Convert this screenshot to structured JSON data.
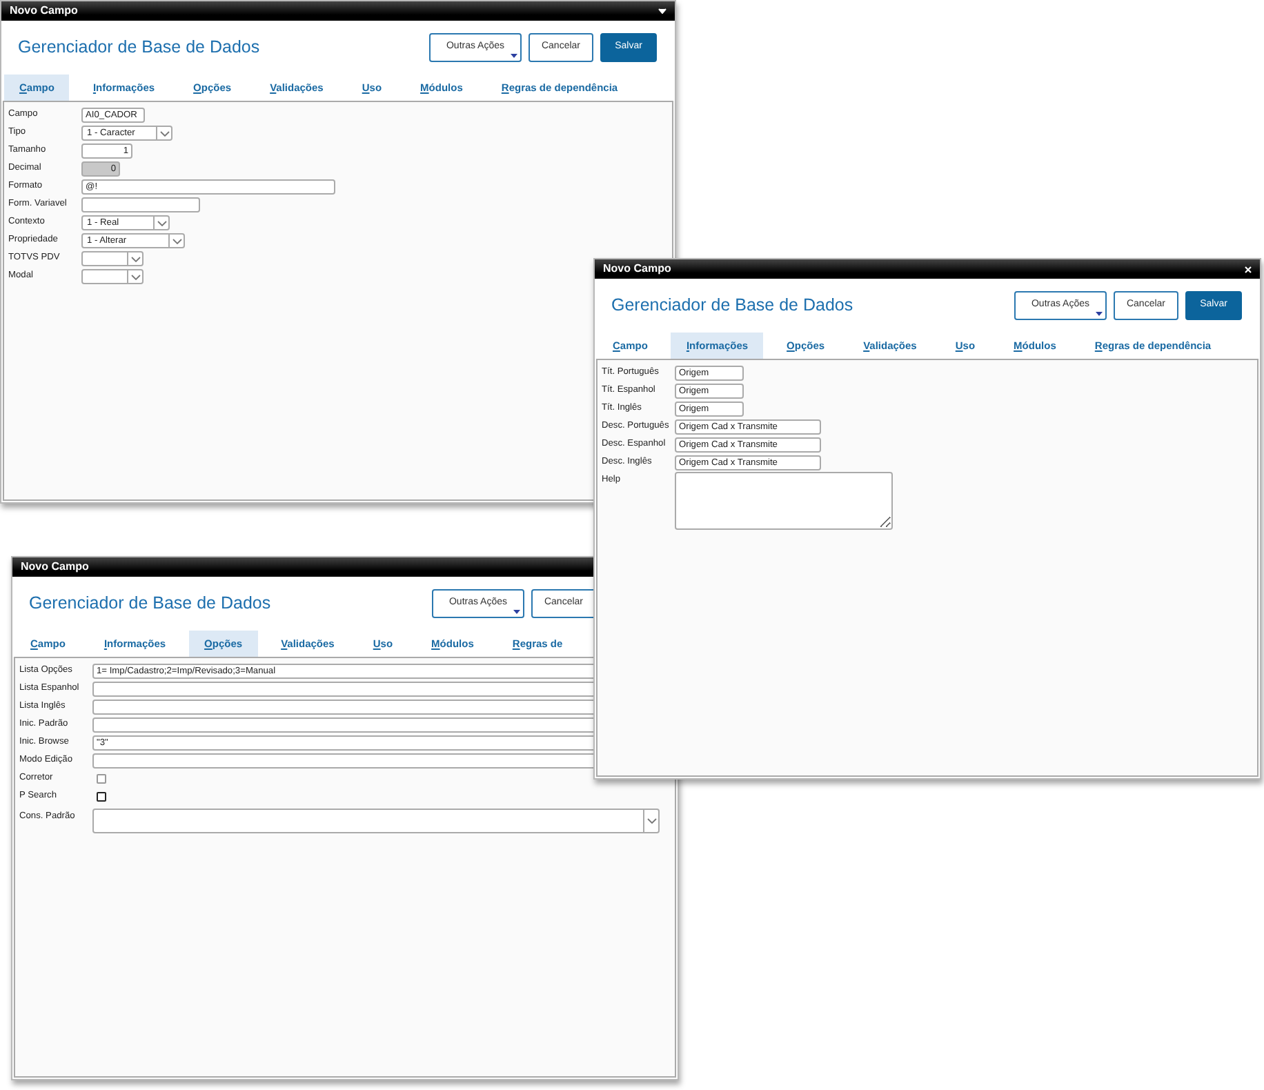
{
  "windows": [
    {
      "title": "Novo Campo",
      "collapse_button": true,
      "heading": "Gerenciador de Base de Dados",
      "buttons": [
        {
          "label": "Outras Ações",
          "kind": "menu"
        },
        {
          "label": "Cancelar",
          "kind": "default"
        },
        {
          "label": "Salvar",
          "kind": "primary"
        }
      ],
      "tabs": [
        {
          "label": "Campo",
          "selected": true
        },
        {
          "label": "Informações",
          "selected": false
        },
        {
          "label": "Opções",
          "selected": false
        },
        {
          "label": "Validações",
          "selected": false
        },
        {
          "label": "Uso",
          "selected": false
        },
        {
          "label": "Módulos",
          "selected": false
        },
        {
          "label": "Regras de dependência",
          "selected": false
        }
      ],
      "fields": [
        {
          "label": "Campo",
          "kind": "text",
          "value": "AI0_CADOR",
          "disabled": false
        },
        {
          "label": "Tipo",
          "kind": "select",
          "value": "1 - Caracter",
          "disabled": false
        },
        {
          "label": "Tamanho",
          "kind": "number",
          "value": "1",
          "disabled": false
        },
        {
          "label": "Decimal",
          "kind": "number",
          "value": "0",
          "disabled": true
        },
        {
          "label": "Formato",
          "kind": "text",
          "value": "@!",
          "disabled": false
        },
        {
          "label": "Form. Variavel",
          "kind": "text",
          "disabled": false
        },
        {
          "label": "Contexto",
          "kind": "select",
          "value": "1 - Real",
          "disabled": false
        },
        {
          "label": "Propriedade",
          "kind": "select",
          "value": "1 - Alterar",
          "disabled": false
        },
        {
          "label": "TOTVS PDV",
          "kind": "select",
          "disabled": false
        },
        {
          "label": "Modal",
          "kind": "select",
          "disabled": false
        }
      ]
    },
    {
      "title": "Novo Campo",
      "close_button": true,
      "heading": "Gerenciador de Base de Dados",
      "buttons": [
        {
          "label": "Outras Ações",
          "kind": "menu"
        },
        {
          "label": "Cancelar",
          "kind": "default"
        },
        {
          "label": "Salvar",
          "kind": "primary"
        }
      ],
      "tabs": [
        {
          "label": "Campo",
          "selected": false
        },
        {
          "label": "Informações",
          "selected": true
        },
        {
          "label": "Opções",
          "selected": false
        },
        {
          "label": "Validações",
          "selected": false
        },
        {
          "label": "Uso",
          "selected": false
        },
        {
          "label": "Módulos",
          "selected": false
        },
        {
          "label": "Regras de dependência",
          "selected": false
        }
      ],
      "fields": [
        {
          "label": "Tít. Português",
          "kind": "text",
          "value": "Origem",
          "disabled": false
        },
        {
          "label": "Tít. Espanhol",
          "kind": "text",
          "value": "Origem",
          "disabled": false
        },
        {
          "label": "Tít. Inglês",
          "kind": "text",
          "value": "Origem",
          "disabled": false
        },
        {
          "label": "Desc. Português",
          "kind": "text",
          "value": "Origem Cad x Transmite",
          "disabled": false
        },
        {
          "label": "Desc. Espanhol",
          "kind": "text",
          "value": "Origem Cad x Transmite",
          "disabled": false
        },
        {
          "label": "Desc. Inglês",
          "kind": "text",
          "value": "Origem Cad x Transmite",
          "disabled": false
        },
        {
          "label": "Help",
          "kind": "textarea",
          "disabled": false
        }
      ]
    },
    {
      "title": "Novo Campo",
      "heading": "Gerenciador de Base de Dados",
      "buttons": [
        {
          "label": "Outras Ações",
          "kind": "menu"
        },
        {
          "label": "Cancelar",
          "kind": "default"
        }
      ],
      "tabs": [
        {
          "label": "Campo",
          "selected": false
        },
        {
          "label": "Informações",
          "selected": false
        },
        {
          "label": "Opções",
          "selected": true
        },
        {
          "label": "Validações",
          "selected": false
        },
        {
          "label": "Uso",
          "selected": false
        },
        {
          "label": "Módulos",
          "selected": false
        },
        {
          "label": "Regras de",
          "selected": false
        }
      ],
      "fields": [
        {
          "label": "Lista Opções",
          "kind": "text",
          "value": "1= Imp/Cadastro;2=Imp/Revisado;3=Manual",
          "disabled": false
        },
        {
          "label": "Lista Espanhol",
          "kind": "text",
          "disabled": false
        },
        {
          "label": "Lista Inglês",
          "kind": "text",
          "disabled": false
        },
        {
          "label": "Inic. Padrão",
          "kind": "text",
          "disabled": false
        },
        {
          "label": "Inic. Browse",
          "kind": "text",
          "value": "\"3\"",
          "disabled": false
        },
        {
          "label": "Modo Edição",
          "kind": "text",
          "disabled": false
        },
        {
          "label": "Corretor",
          "kind": "checkbox",
          "checked": false,
          "disabled": true
        },
        {
          "label": "P Search",
          "kind": "checkbox",
          "checked": false,
          "disabled": false
        },
        {
          "label": "Cons. Padrão",
          "kind": "select",
          "disabled": false
        }
      ]
    }
  ]
}
